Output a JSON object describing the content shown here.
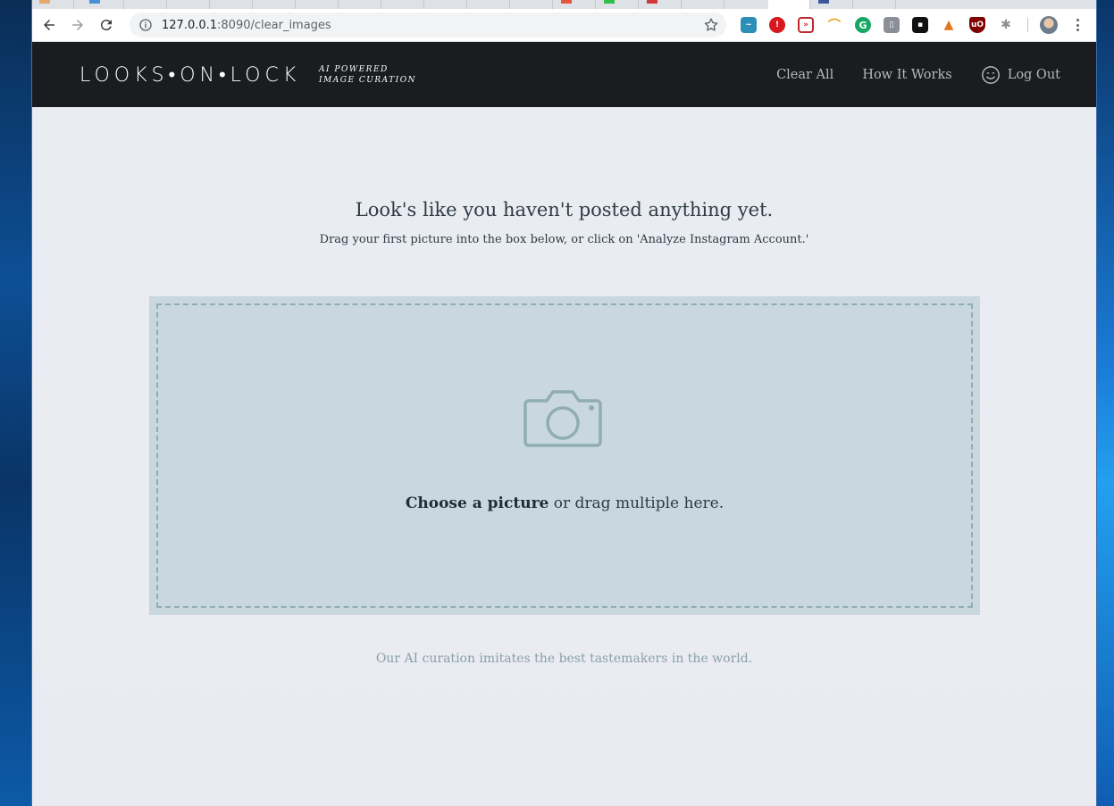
{
  "browser": {
    "url_host": "127.0.0.1",
    "url_path": ":8090/clear_images"
  },
  "site": {
    "logo": "LOOKS•ON•LOCK",
    "tagline_line1": "AI POWERED",
    "tagline_line2": "IMAGE CURATION",
    "nav": {
      "clear_all": "Clear All",
      "how_it_works": "How It Works",
      "log_out": "Log Out"
    }
  },
  "main": {
    "headline": "Look's like you haven't posted anything yet.",
    "subheadline": "Drag your first picture into the box below, or click on 'Analyze Instagram Account.'",
    "dropzone": {
      "choose_label": "Choose a picture",
      "rest_label": " or drag multiple here."
    },
    "footer_note": "Our AI curation imitates the best tastemakers in the world."
  },
  "colors": {
    "header_bg": "#1a1c1f",
    "dropzone_bg": "#c8d8de",
    "dropzone_border": "#90adb3"
  }
}
